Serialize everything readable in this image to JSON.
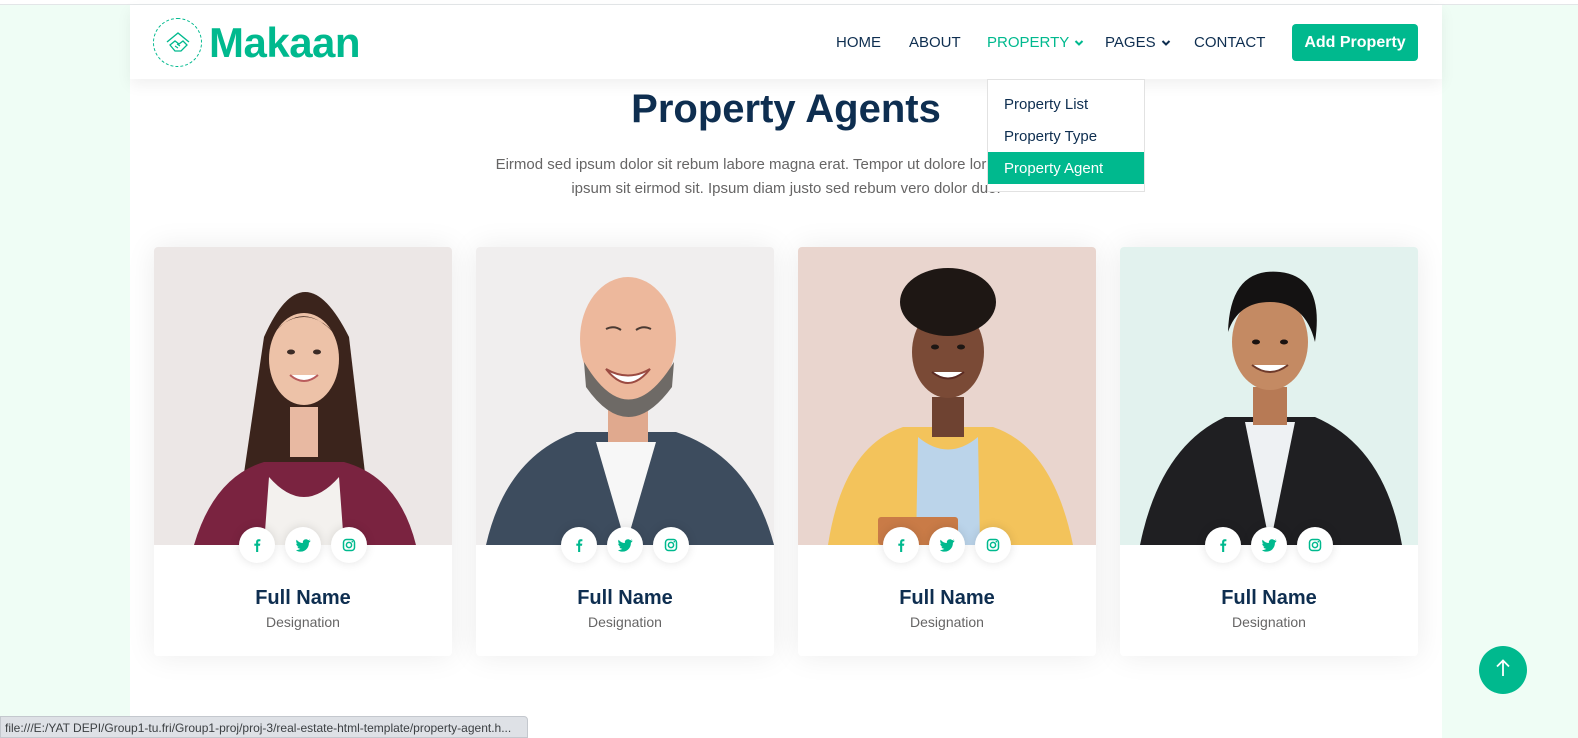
{
  "brand": {
    "name": "Makaan",
    "logo_icon": "handshake-house-icon",
    "accent": "#00B98E",
    "dark": "#0E2E50"
  },
  "nav": {
    "items": [
      {
        "label": "HOME",
        "active": false,
        "dropdown": false
      },
      {
        "label": "ABOUT",
        "active": false,
        "dropdown": false
      },
      {
        "label": "PROPERTY",
        "active": true,
        "dropdown": true
      },
      {
        "label": "PAGES",
        "active": false,
        "dropdown": true
      },
      {
        "label": "CONTACT",
        "active": false,
        "dropdown": false
      }
    ],
    "cta": "Add Property"
  },
  "dropdown": {
    "items": [
      {
        "label": "Property List",
        "active": false
      },
      {
        "label": "Property Type",
        "active": false
      },
      {
        "label": "Property Agent",
        "active": true
      }
    ]
  },
  "section": {
    "title": "Property Agents",
    "subtitle": "Eirmod sed ipsum dolor sit rebum labore magna erat. Tempor ut dolore lorem kasd vero ipsum sit eirmod sit. Ipsum diam justo sed rebum vero dolor duo."
  },
  "agents": [
    {
      "name": "Full Name",
      "designation": "Designation",
      "photo": "woman-agent-photo"
    },
    {
      "name": "Full Name",
      "designation": "Designation",
      "photo": "bald-man-agent-photo"
    },
    {
      "name": "Full Name",
      "designation": "Designation",
      "photo": "woman-yellow-jacket-agent-photo"
    },
    {
      "name": "Full Name",
      "designation": "Designation",
      "photo": "young-man-suit-agent-photo"
    }
  ],
  "social_icons": [
    "facebook-icon",
    "twitter-icon",
    "instagram-icon"
  ],
  "back_to_top_icon": "arrow-up-icon",
  "status_bar": {
    "url": "file:///E:/YAT DEPI/Group1-tu.fri/Group1-proj/proj-3/real-estate-html-template/property-agent.h..."
  }
}
